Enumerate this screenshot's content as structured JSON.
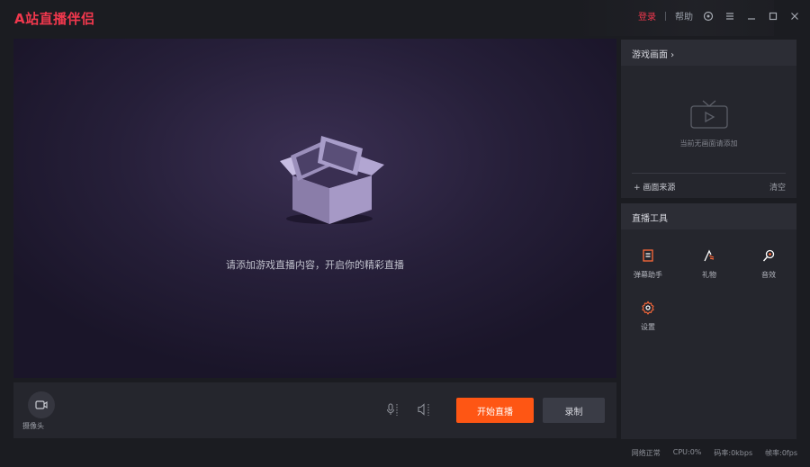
{
  "app": {
    "title": "A站直播伴侣"
  },
  "titlebar": {
    "login": "登录",
    "help": "帮助"
  },
  "preview": {
    "hint": "请添加游戏直播内容，开启你的精彩直播"
  },
  "bottombar": {
    "camera_label": "摄像头",
    "start_button": "开始直播",
    "record_button": "录制"
  },
  "scene_panel": {
    "title": "游戏画面 ›",
    "empty_text": "当前无画面请添加",
    "add_scene": "+ 画面来源",
    "clear": "清空"
  },
  "tools_panel": {
    "title": "直播工具",
    "tools": [
      {
        "label": "弹幕助手",
        "icon": "danmaku-icon"
      },
      {
        "label": "礼物",
        "icon": "gift-icon"
      },
      {
        "label": "音效",
        "icon": "sound-effect-icon"
      },
      {
        "label": "设置",
        "icon": "settings-icon"
      }
    ]
  },
  "statusbar": {
    "network": "网络正常",
    "cpu": "CPU:0%",
    "bitrate": "码率:0kbps",
    "fps": "帧率:0fps"
  },
  "colors": {
    "accent": "#fe5614",
    "logo": "#f0384d",
    "panel": "#25262d",
    "background": "#1b1c21"
  }
}
